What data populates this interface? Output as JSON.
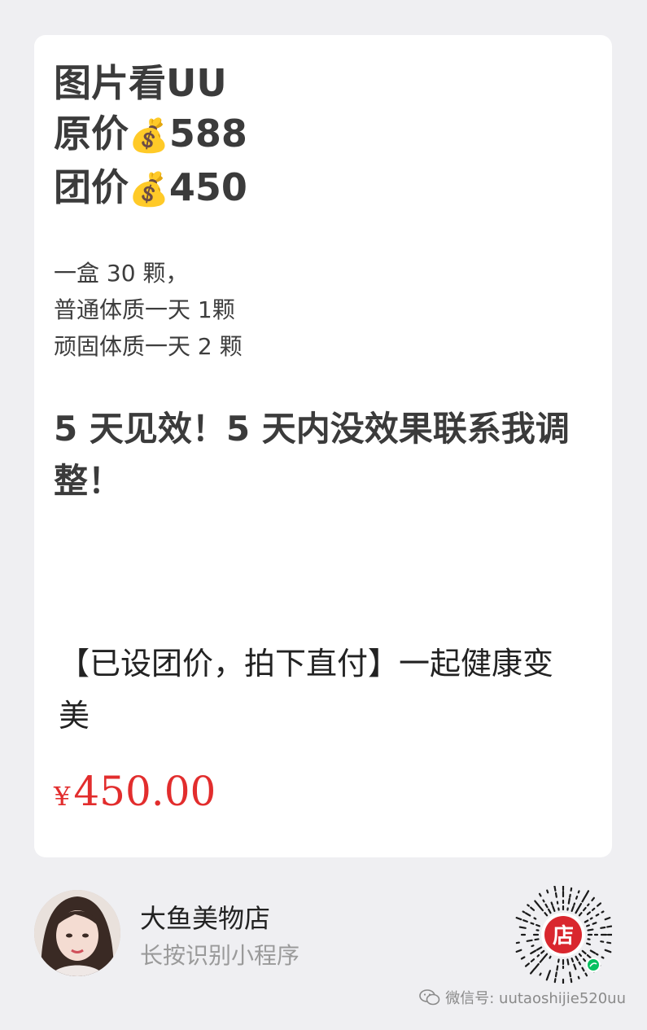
{
  "card": {
    "headline": {
      "line1": "图片看UU",
      "line2_label": "原价",
      "line2_icon": "money-bag-icon",
      "line2_value": "588",
      "line3_label": "团价",
      "line3_icon": "money-bag-icon",
      "line3_value": "450"
    },
    "description": [
      "一盒 30 颗，",
      "普通体质一天 1颗",
      "顽固体质一天 2 颗"
    ],
    "promo": "5 天见效！5 天内没效果联系我调整！",
    "product_title": "【已设团价，拍下直付】一起健康变美",
    "price_symbol": "¥",
    "price_value": "450.00",
    "price_color": "#e22d2d"
  },
  "shop": {
    "name": "大鱼美物店",
    "hint": "长按识别小程序",
    "qr_badge": "店",
    "qr_badge_color": "#d9272e"
  },
  "watermark": {
    "icon": "wechat-icon",
    "text": "微信号: uutaoshijie520uu"
  }
}
